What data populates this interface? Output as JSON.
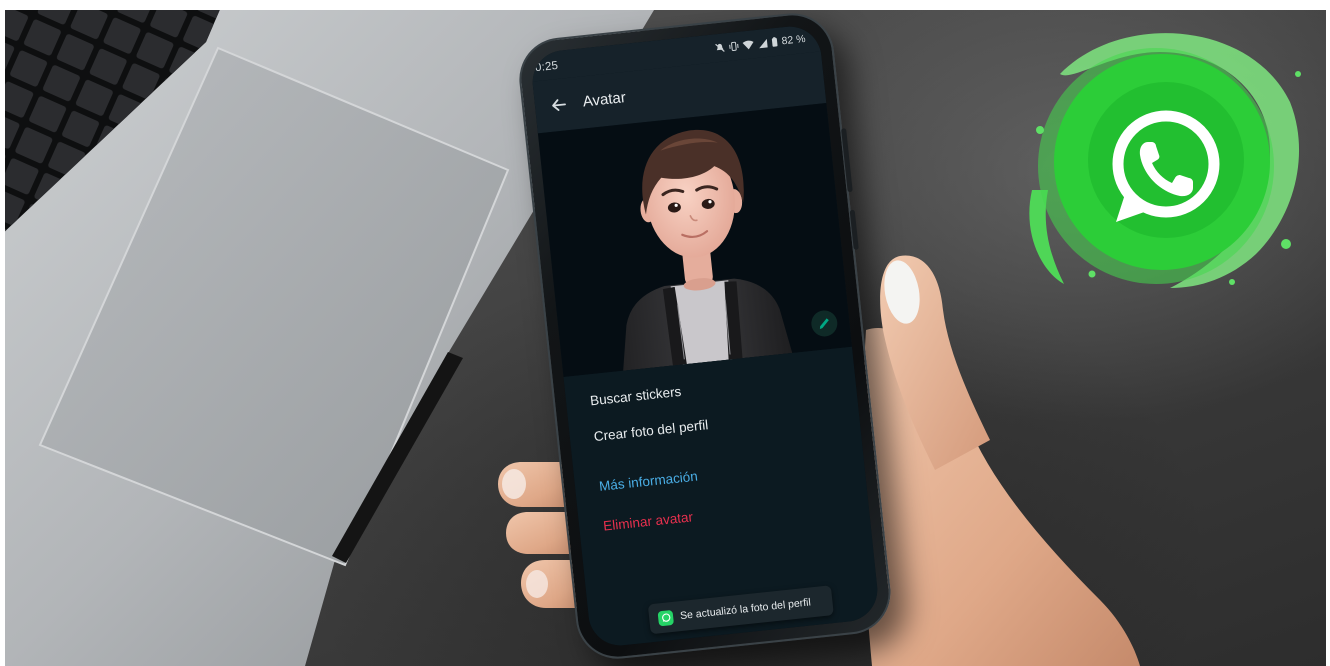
{
  "phone": {
    "status_bar": {
      "time": "0:25",
      "battery": "82 %",
      "icons": [
        "mute-icon",
        "vibrate-icon",
        "wifi-icon",
        "signal-icon",
        "battery-icon"
      ]
    },
    "app_bar": {
      "back_icon": "arrow-left-icon",
      "title": "Avatar"
    },
    "avatar": {
      "edit_icon": "pencil-icon"
    },
    "menu": {
      "items": [
        {
          "label": "Buscar stickers",
          "color": "#e9edef"
        },
        {
          "label": "Crear foto del perfil",
          "color": "#e9edef"
        },
        {
          "label": "Más información",
          "color": "#4aaee6"
        },
        {
          "label": "Eliminar avatar",
          "color": "#e8304e"
        }
      ]
    },
    "snackbar": {
      "icon": "whatsapp-icon",
      "message": "Se actualizó la foto del perfil"
    }
  },
  "logo": {
    "icon": "whatsapp-logo-icon",
    "color": "#25d366"
  },
  "colors": {
    "accent": "#00a884",
    "screen_background": "#0b171e"
  }
}
